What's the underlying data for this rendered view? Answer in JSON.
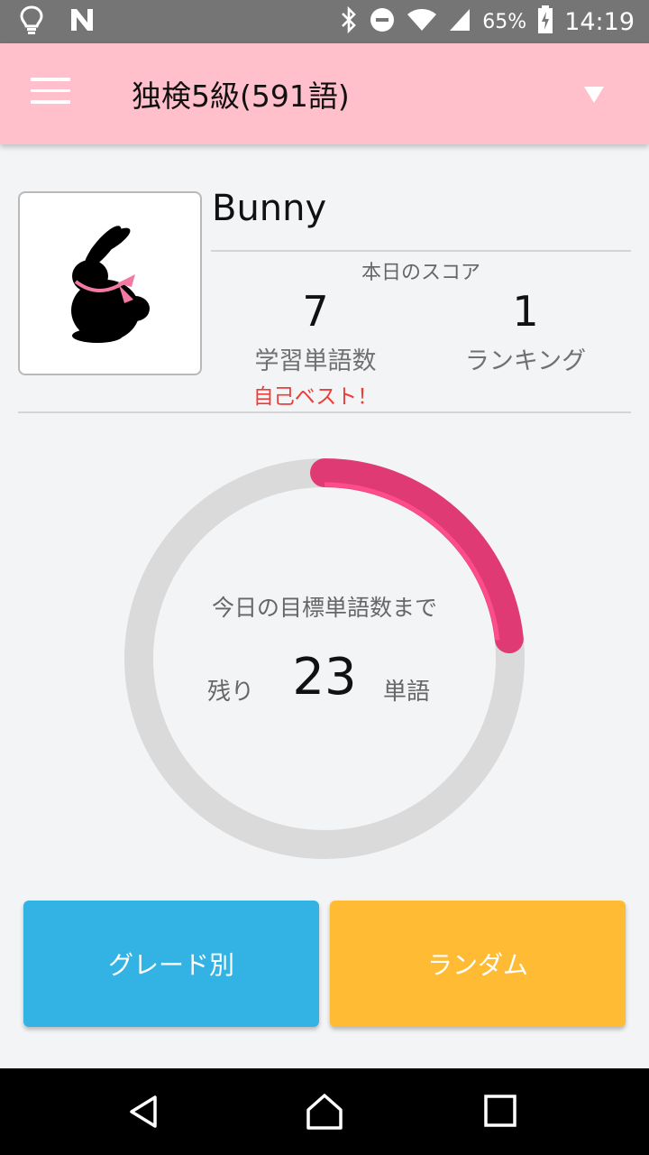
{
  "status_bar": {
    "battery_percent": "65%",
    "time": "14:19",
    "icons": [
      "lightbulb-icon",
      "n-icon",
      "bluetooth-icon",
      "do-not-disturb-icon",
      "wifi-icon",
      "cell-signal-icon",
      "battery-charging-icon"
    ]
  },
  "app_bar": {
    "title": "独検5級(591語)",
    "menu_icon": "hamburger-menu-icon",
    "dropdown_icon": "triangle-down-icon",
    "background": "#ffbfcb"
  },
  "profile": {
    "username": "Bunny",
    "avatar_icon": "rabbit-avatar-icon",
    "score_caption": "本日のスコア",
    "stats": [
      {
        "value": "7",
        "label": "学習単語数",
        "note": "自己ベスト！"
      },
      {
        "value": "1",
        "label": "ランキング"
      }
    ]
  },
  "goal": {
    "caption": "今日の目標単語数まで",
    "prefix": "残り",
    "remaining": "23",
    "suffix": "単語",
    "progress_fraction": 0.233,
    "ring_color": "#e03a74",
    "track_color": "#dadada"
  },
  "actions": {
    "grade": {
      "label": "グレード別",
      "color": "#33b3e4"
    },
    "random": {
      "label": "ランダム",
      "color": "#ffbb33"
    }
  },
  "nav_bar": {
    "icons": [
      "back-icon",
      "home-icon",
      "recents-icon"
    ]
  }
}
